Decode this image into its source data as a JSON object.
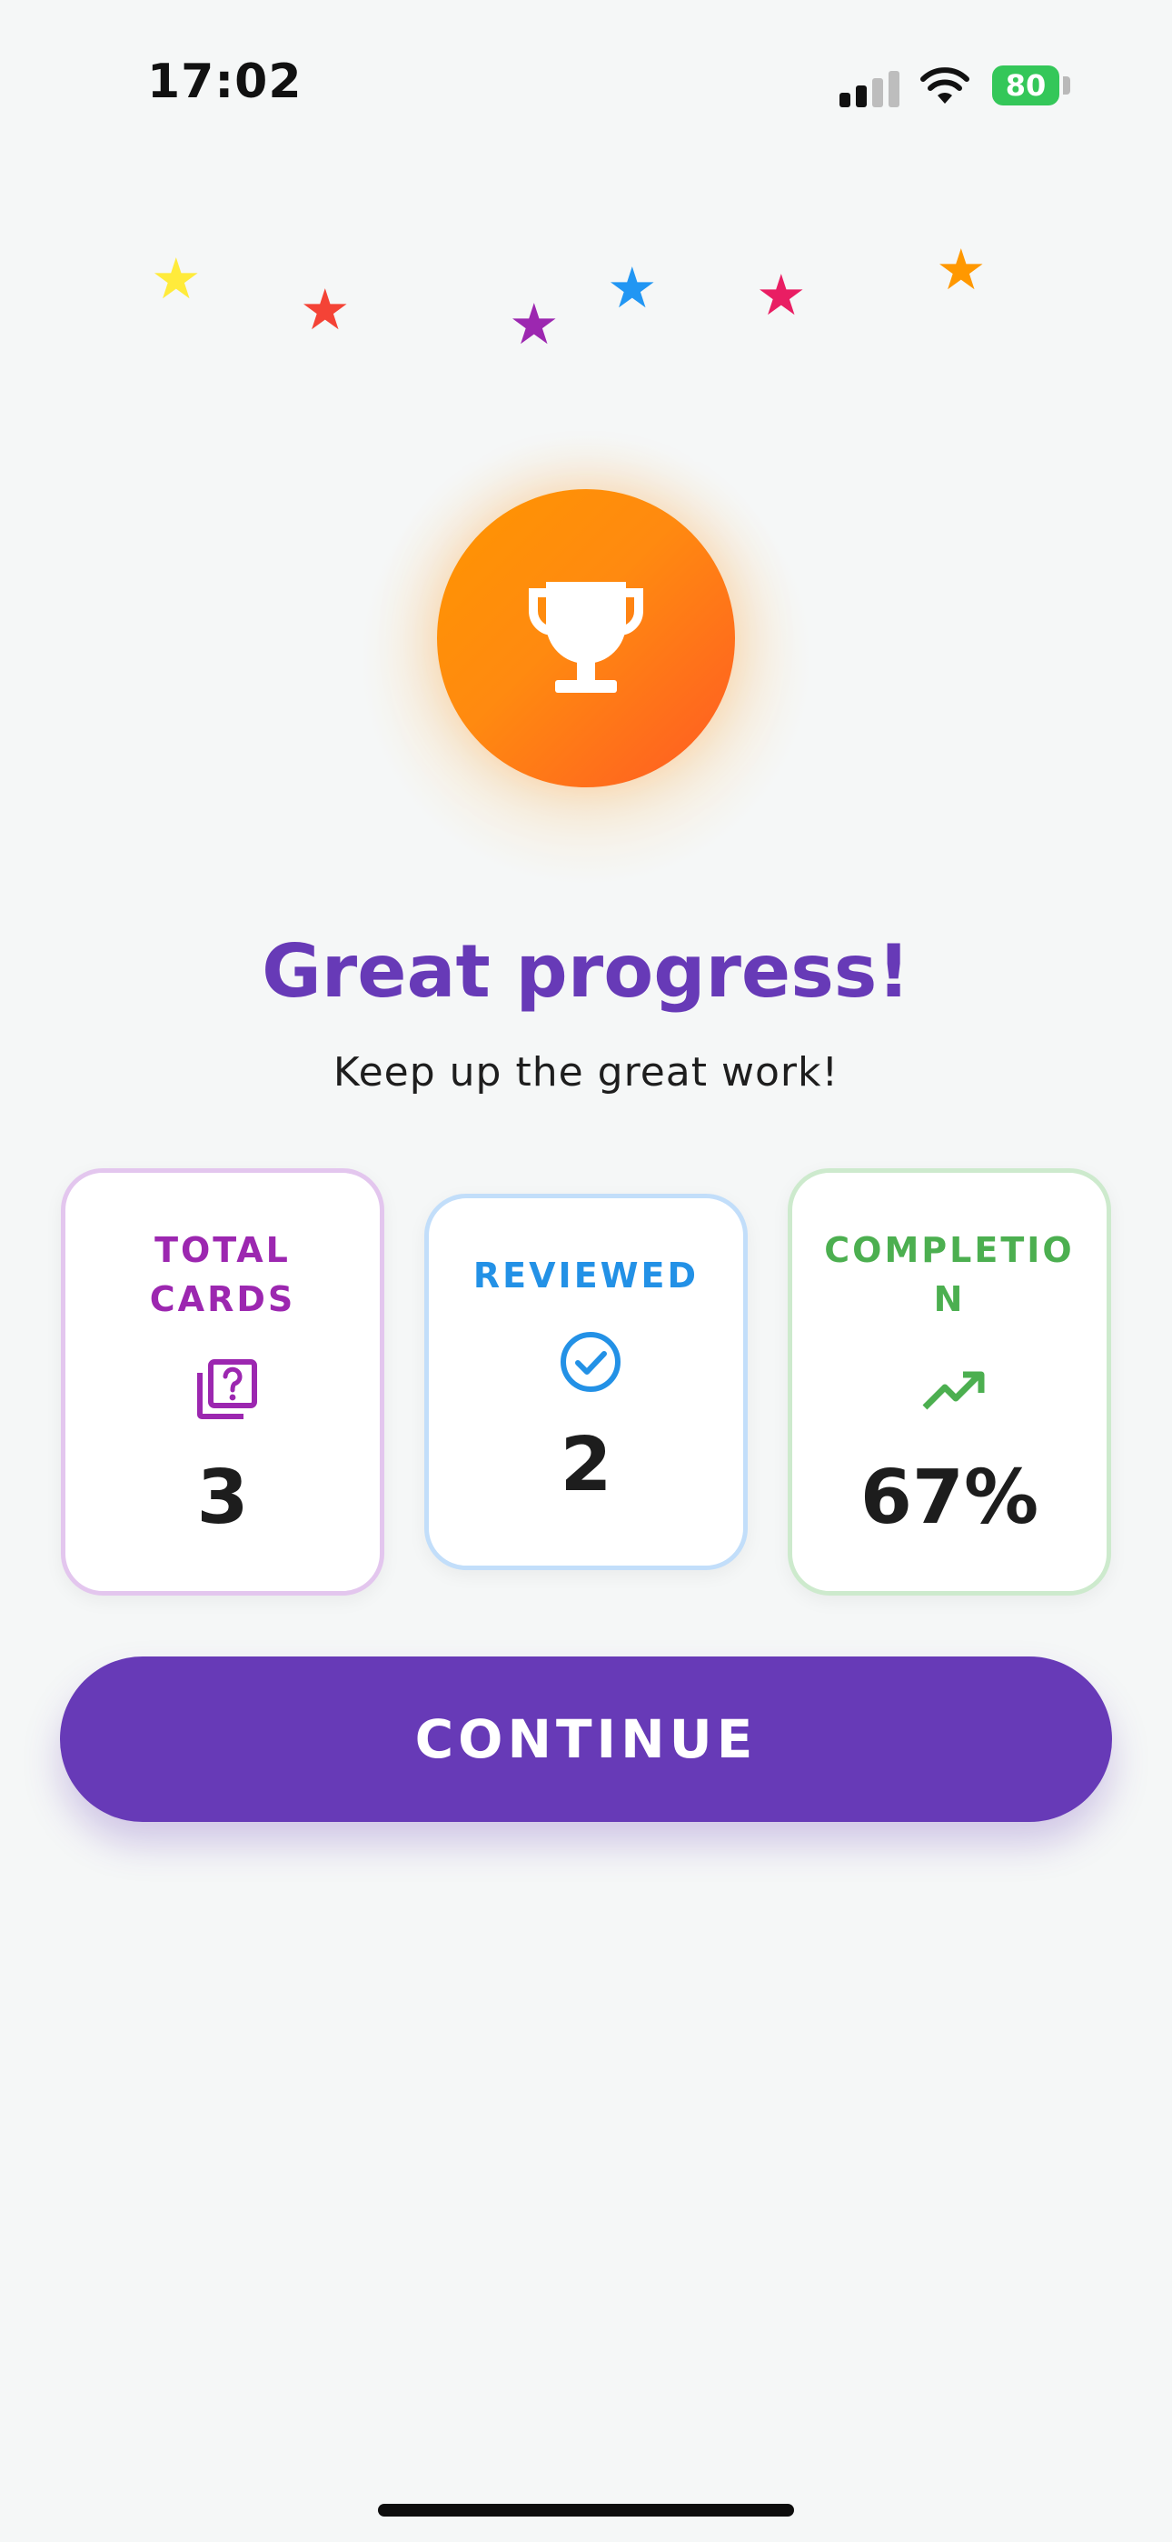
{
  "status_bar": {
    "time": "17:02",
    "battery": "80",
    "icons": [
      "signal-icon",
      "wifi-icon",
      "battery-icon"
    ]
  },
  "colors": {
    "accent": "#673ab7",
    "trophy_start": "#ff9500",
    "trophy_end": "#ff5a24",
    "total_cards": "#9c27b0",
    "reviewed": "#2391e6",
    "completion": "#4caf50",
    "star_colors": [
      "#ffeb3b",
      "#f44336",
      "#9c27b0",
      "#2196f3",
      "#e91e63",
      "#ff9800"
    ]
  },
  "celebration": {
    "icon": "trophy-icon",
    "title": "Great progress!",
    "subtitle": "Keep up the great work!"
  },
  "stats": {
    "total_cards": {
      "label": "TOTAL CARDS",
      "icon": "question-cards-icon",
      "value": "3"
    },
    "reviewed": {
      "label": "REVIEWED",
      "icon": "check-circle-icon",
      "value": "2"
    },
    "completion": {
      "label": "COMPLETION",
      "icon": "trending-up-icon",
      "value": "67%"
    }
  },
  "actions": {
    "continue_label": "CONTINUE"
  }
}
